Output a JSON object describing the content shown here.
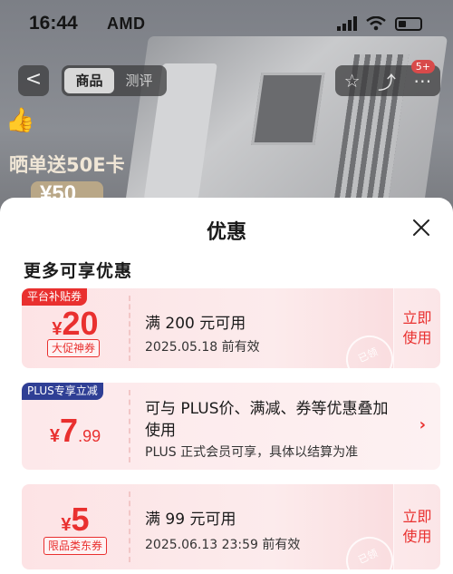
{
  "status_bar": {
    "time": "16:44",
    "brand": "AMD"
  },
  "nav": {
    "back": "<",
    "tabs": [
      {
        "label": "商品",
        "active": true
      },
      {
        "label": "测评",
        "active": false
      }
    ],
    "badge": "5+"
  },
  "promo": {
    "text": "晒单送50E卡",
    "amount": "¥50"
  },
  "sheet": {
    "title": "优惠",
    "section_title": "更多可享优惠",
    "coupons": [
      {
        "tag": "平台补贴券",
        "tag_color": "#e9302f",
        "currency": "¥",
        "amount": "20",
        "decimal": "",
        "sub_tag": "大促神券",
        "condition": "满 200 元可用",
        "valid": "2025.05.18 前有效",
        "action": "立即使用",
        "stamp": "已领"
      },
      {
        "tag": "PLUS专享立减",
        "tag_color": "#2f3f95",
        "currency": "¥",
        "amount": "7",
        "decimal": ".99",
        "condition_line1": "可与 PLUS价、满减、券等优惠叠加",
        "condition_line2": "使用",
        "note": "PLUS 正式会员可享，具体以结算为准",
        "chevron": "›"
      },
      {
        "currency": "¥",
        "amount": "5",
        "decimal": "",
        "sub_tag": "限品类东券",
        "condition": "满 99 元可用",
        "valid": "2025.06.13 23:59 前有效",
        "action": "立即使用",
        "stamp": "已领"
      }
    ]
  },
  "colors": {
    "accent": "#e9302f",
    "plus": "#2f3f95",
    "coupon_bg": "#fde4e6",
    "sheet_bg": "#ffffff"
  }
}
